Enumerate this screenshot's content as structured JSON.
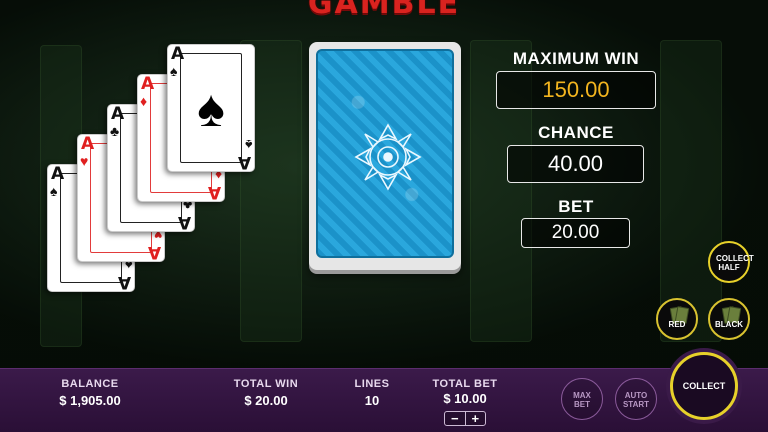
{
  "title": "GAMBLE",
  "cards": [
    {
      "rank": "A",
      "suit": "♠",
      "color": "black"
    },
    {
      "rank": "A",
      "suit": "♥",
      "color": "red"
    },
    {
      "rank": "A",
      "suit": "♣",
      "color": "black"
    },
    {
      "rank": "A",
      "suit": "♦",
      "color": "red"
    },
    {
      "rank": "A",
      "suit": "♠",
      "color": "black"
    }
  ],
  "deck": {
    "icon": "card-back-ornament"
  },
  "maximum_win": {
    "label": "MAXIMUM WIN",
    "value": "150.00"
  },
  "chance": {
    "label": "CHANCE",
    "value": "40.00"
  },
  "bet": {
    "label": "BET",
    "value": "20.00"
  },
  "buttons": {
    "collect_half": "COLLECT HALF",
    "red": "RED",
    "black": "BLACK",
    "max_bet": "MAX BET",
    "auto_start": "AUTO START",
    "collect": "COLLECT"
  },
  "bar": {
    "balance_label": "BALANCE",
    "balance_value": "$ 1,905.00",
    "total_win_label": "TOTAL WIN",
    "total_win_value": "$ 20.00",
    "lines_label": "LINES",
    "lines_value": "10",
    "total_bet_label": "TOTAL BET",
    "total_bet_value": "$ 10.00",
    "minus": "−",
    "plus": "+"
  },
  "colors": {
    "title": "#d9231f",
    "gold": "#f3b51f",
    "bar": "#3b1a4a",
    "accent_ring": "#e7d12a"
  }
}
